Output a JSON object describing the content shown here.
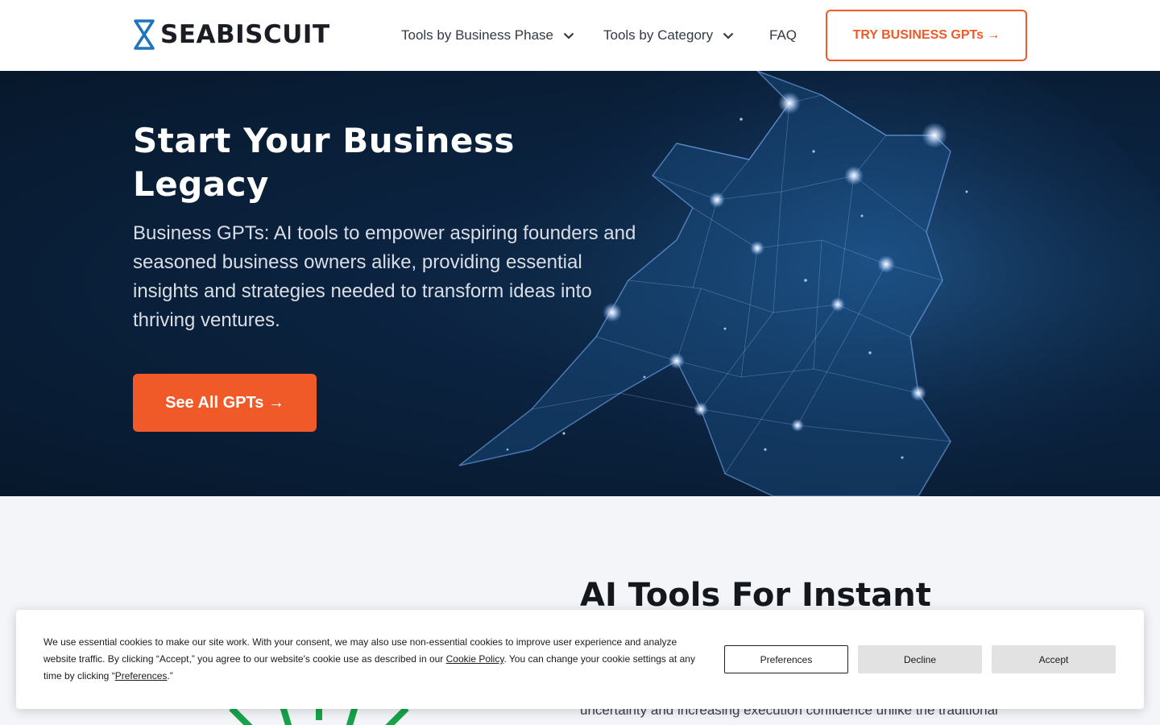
{
  "header": {
    "logo_text": "SEABISCUIT",
    "nav": [
      {
        "label": "Tools by Business Phase"
      },
      {
        "label": "Tools by Category"
      },
      {
        "label": "FAQ"
      }
    ],
    "cta_label": "TRY BUSINESS GPTs →"
  },
  "hero": {
    "title": "Start Your Business Legacy",
    "subtitle": "Business GPTs: AI tools to empower aspiring founders and seasoned business owners alike, providing essential insights and strategies needed to transform ideas into thriving ventures.",
    "cta_label": "See All GPTs →"
  },
  "section": {
    "title": "AI Tools For Instant",
    "body": "uncertainty and increasing execution confidence unlike the traditional"
  },
  "cookie_banner": {
    "text_part1": "We use essential cookies to make our site work. With your consent, we may also use non-essential cookies to improve user experience and analyze website traffic. By clicking “Accept,” you agree to our website's cookie use as described in our ",
    "cookie_policy_link": "Cookie Policy",
    "text_part2": ". You can change your cookie settings at any time by clicking “",
    "preferences_link": "Preferences",
    "text_part3": ".”",
    "buttons": {
      "preferences": "Preferences",
      "decline": "Decline",
      "accept": "Accept"
    }
  },
  "colors": {
    "accent": "#f05a28",
    "hero_bg": "#0b2340",
    "logo_blue": "#1e73be",
    "graphic_green": "#17a34a"
  },
  "icons": [
    "seabiscuit-logo-icon",
    "chevron-down-icon",
    "constellation-horse-graphic"
  ]
}
